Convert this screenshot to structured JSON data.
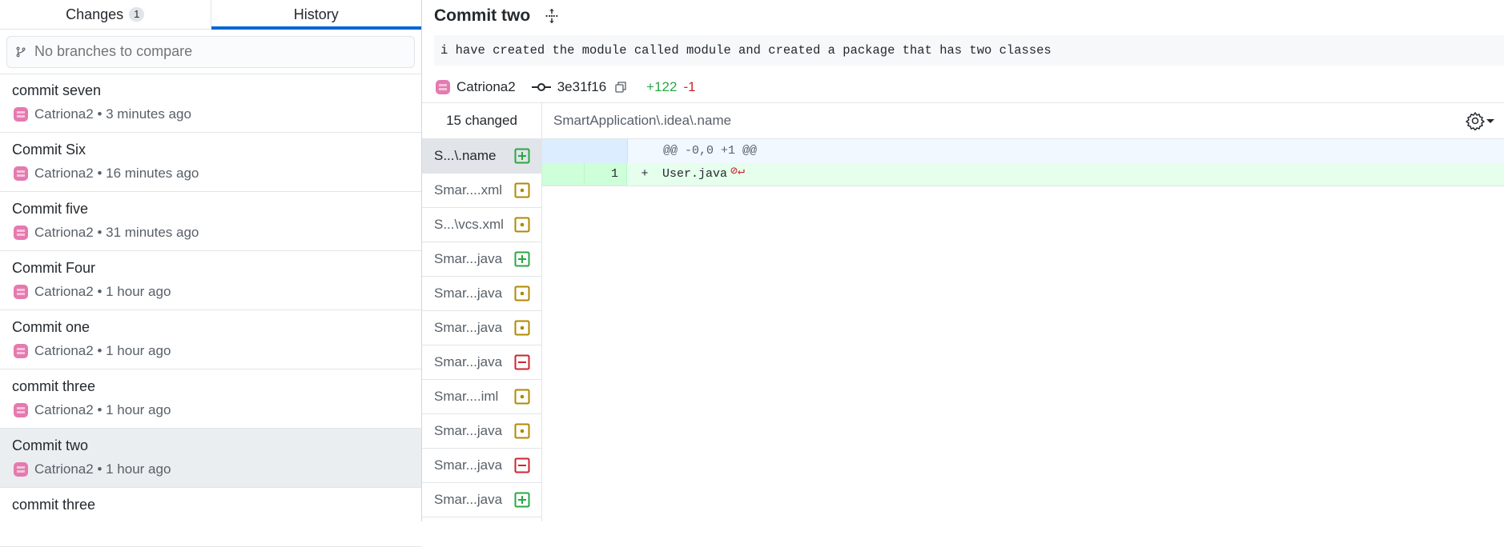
{
  "tabs": {
    "changes_label": "Changes",
    "changes_count": "1",
    "history_label": "History"
  },
  "compare": {
    "placeholder": "No branches to compare"
  },
  "commits": [
    {
      "title": "commit seven",
      "author": "Catriona2",
      "time": "3 minutes ago"
    },
    {
      "title": "Commit Six",
      "author": "Catriona2",
      "time": "16 minutes ago"
    },
    {
      "title": "Commit five",
      "author": "Catriona2",
      "time": "31 minutes ago"
    },
    {
      "title": "Commit Four",
      "author": "Catriona2",
      "time": "1 hour ago"
    },
    {
      "title": "Commit one",
      "author": "Catriona2",
      "time": "1 hour ago"
    },
    {
      "title": "commit three",
      "author": "Catriona2",
      "time": "1 hour ago"
    },
    {
      "title": "Commit two",
      "author": "Catriona2",
      "time": "1 hour ago"
    },
    {
      "title": "commit three",
      "author": "",
      "time": ""
    }
  ],
  "selected_commit": {
    "title": "Commit two",
    "description": "i have created the module called module and created a package that has two classes",
    "author": "Catriona2",
    "sha": "3e31f16",
    "additions": "+122",
    "deletions": "-1"
  },
  "files": {
    "changed_label": "15 changed",
    "items": [
      {
        "name": "S...\\.name",
        "status": "added"
      },
      {
        "name": "Smar....xml",
        "status": "modified"
      },
      {
        "name": "S...\\vcs.xml",
        "status": "modified"
      },
      {
        "name": "Smar...java",
        "status": "added"
      },
      {
        "name": "Smar...java",
        "status": "modified"
      },
      {
        "name": "Smar...java",
        "status": "modified"
      },
      {
        "name": "Smar...java",
        "status": "deleted"
      },
      {
        "name": "Smar....iml",
        "status": "modified"
      },
      {
        "name": "Smar...java",
        "status": "modified"
      },
      {
        "name": "Smar...java",
        "status": "deleted"
      },
      {
        "name": "Smar...java",
        "status": "added"
      }
    ]
  },
  "diff": {
    "path": "SmartApplication\\.idea\\.name",
    "hunk_header": "@@ -0,0 +1 @@",
    "line_number": "1",
    "line_prefix": "+",
    "line_text": "User.java"
  },
  "colors": {
    "accent": "#0366d6",
    "added": "#28a745",
    "deleted": "#cb2431",
    "modified": "#b08800",
    "avatar": "#e57ab0"
  }
}
